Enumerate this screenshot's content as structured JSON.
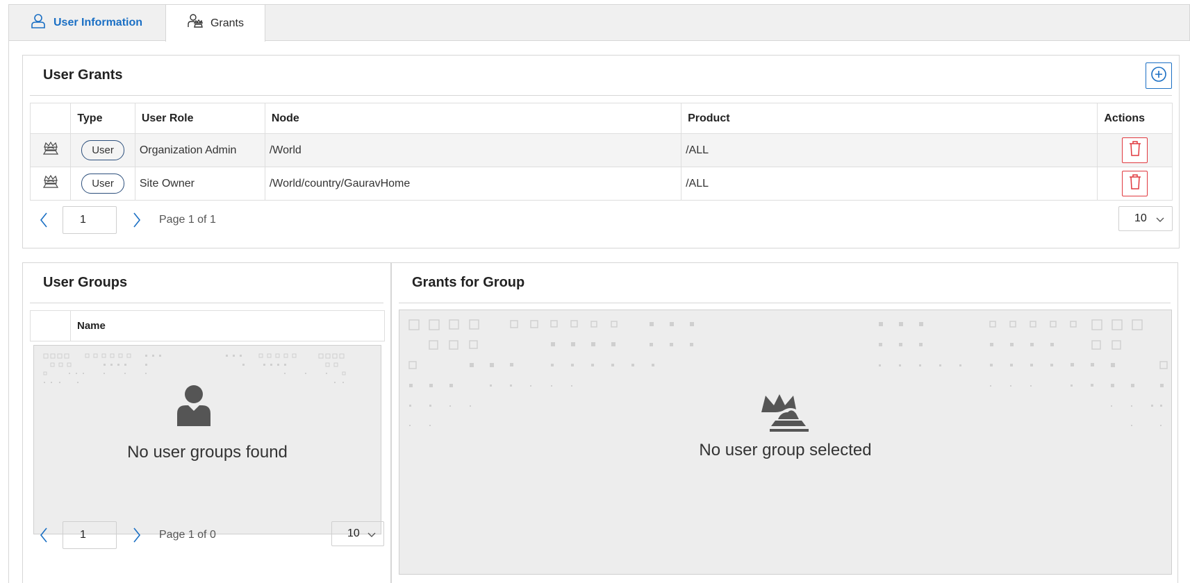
{
  "tabs": [
    {
      "label": "User Information",
      "icon": "user-icon",
      "active": false
    },
    {
      "label": "Grants",
      "icon": "user-grants-icon",
      "active": true
    }
  ],
  "user_grants": {
    "title": "User Grants",
    "add_icon": "plus-circle-icon",
    "columns": [
      "",
      "Type",
      "User Role",
      "Node",
      "Product",
      "Actions"
    ],
    "rows": [
      {
        "icon": "grant-icon",
        "type": "User",
        "role": "Organization Admin",
        "node": "/World",
        "product": "/ALL",
        "action_icon": "trash-icon"
      },
      {
        "icon": "grant-icon",
        "type": "User",
        "role": "Site Owner",
        "node": "/World/country/GauravHome",
        "product": "/ALL",
        "action_icon": "trash-icon"
      }
    ],
    "pager": {
      "page": "1",
      "label": "Page 1 of 1",
      "page_size": "10"
    }
  },
  "user_groups": {
    "title": "User Groups",
    "columns": [
      "",
      "Name"
    ],
    "empty_message": "No user groups found",
    "empty_icon": "user-silhouette-icon",
    "pager": {
      "page": "1",
      "label": "Page 1 of 0",
      "page_size": "10"
    }
  },
  "grants_for_group": {
    "title": "Grants for Group",
    "empty_message": "No user group selected",
    "empty_icon": "crown-grant-icon"
  },
  "colors": {
    "accent": "#1a6fc4",
    "danger": "#e0383e",
    "border": "#d6d6d6",
    "empty_bg": "#ededed"
  }
}
